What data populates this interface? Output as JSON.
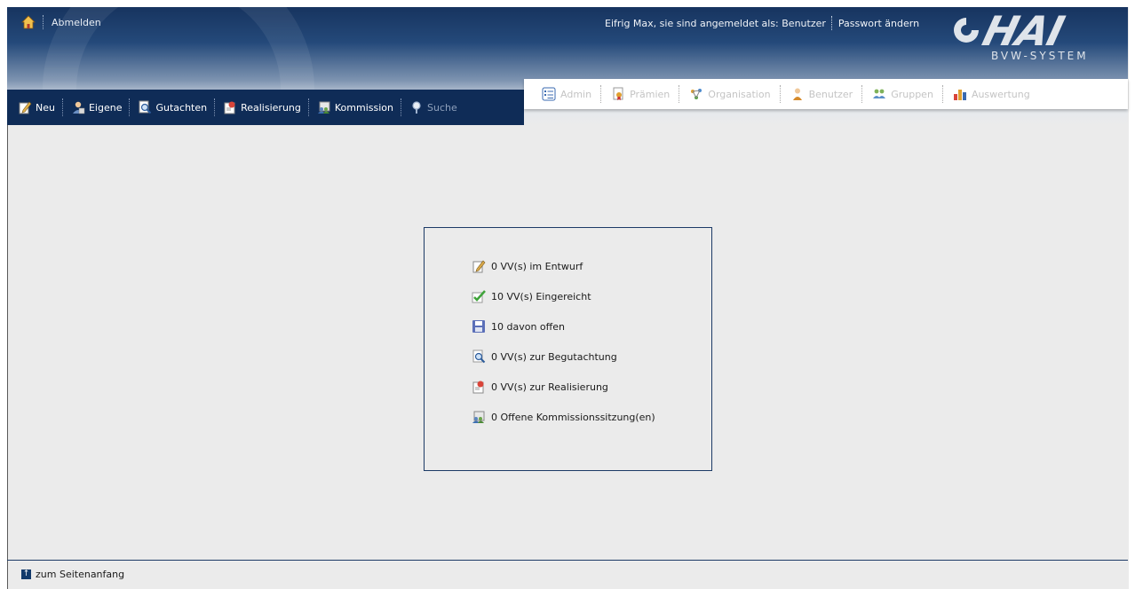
{
  "topbar": {
    "logout_label": "Abmelden",
    "user_text": "Eifrig Max, sie sind angemeldet als: Benutzer",
    "password_label": "Passwort ändern"
  },
  "logo": {
    "word": "HAI",
    "subtitle": "BVW-SYSTEM"
  },
  "main_nav": [
    {
      "label": "Neu",
      "icon": "edit-icon",
      "enabled": true
    },
    {
      "label": "Eigene",
      "icon": "person-icon",
      "enabled": true
    },
    {
      "label": "Gutachten",
      "icon": "magnifier-icon",
      "enabled": true
    },
    {
      "label": "Realisierung",
      "icon": "realization-icon",
      "enabled": true
    },
    {
      "label": "Kommission",
      "icon": "commission-icon",
      "enabled": true
    },
    {
      "label": "Suche",
      "icon": "search-icon",
      "enabled": false
    }
  ],
  "admin_nav": [
    {
      "label": "Admin",
      "icon": "list-icon"
    },
    {
      "label": "Prämien",
      "icon": "award-icon"
    },
    {
      "label": "Organisation",
      "icon": "organisation-icon"
    },
    {
      "label": "Benutzer",
      "icon": "user-icon"
    },
    {
      "label": "Gruppen",
      "icon": "group-icon"
    },
    {
      "label": "Auswertung",
      "icon": "chart-icon"
    }
  ],
  "stats": [
    {
      "text": "0 VV(s) im Entwurf",
      "icon": "draft-icon"
    },
    {
      "text": "10 VV(s) Eingereicht",
      "icon": "check-icon"
    },
    {
      "text": "10 davon offen",
      "icon": "save-icon"
    },
    {
      "text": "0 VV(s) zur Begutachtung",
      "icon": "review-icon"
    },
    {
      "text": "0 VV(s) zur Realisierung",
      "icon": "realization-icon"
    },
    {
      "text": "0 Offene Kommissionssitzung(en)",
      "icon": "commission-icon"
    }
  ],
  "footer": {
    "to_top_label": "zum Seitenanfang"
  },
  "colors": {
    "header_dark": "#17345f",
    "nav_bg": "#0f2c57",
    "panel_border": "#1c3a66",
    "page_bg": "#ebebeb"
  }
}
